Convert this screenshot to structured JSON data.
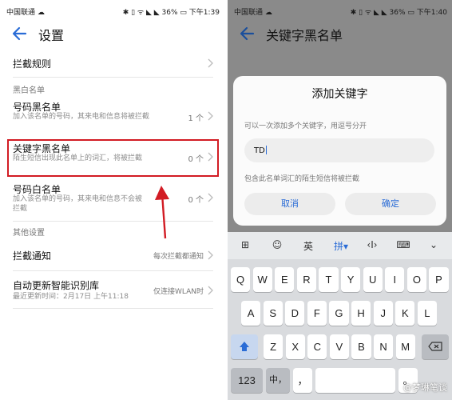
{
  "left": {
    "status": {
      "carrier": "中国联通 ☁",
      "right": "✱ ▯ ᯤ ◣ ◣ 36% ▭ 下午1:39"
    },
    "title": "设置",
    "intercept_rules": "拦截规则",
    "section_bw": "黑白名单",
    "number_blacklist": {
      "title": "号码黑名单",
      "desc": "加入该名单的号码，其来电和信息将被拦截",
      "count": "1 个"
    },
    "keyword_blacklist": {
      "title": "关键字黑名单",
      "desc": "陌生短信出现此名单上的词汇，将被拦截",
      "count": "0 个"
    },
    "number_whitelist": {
      "title": "号码白名单",
      "desc": "加入该名单的号码，其来电和信息不会被拦截",
      "count": "0 个"
    },
    "section_other": "其他设置",
    "intercept_notify": {
      "title": "拦截通知",
      "value": "每次拦截都通知"
    },
    "auto_update": {
      "title": "自动更新智能识别库",
      "desc": "最近更新时间：2月17日 上午11:18",
      "value": "仅连接WLAN时"
    }
  },
  "right": {
    "status": {
      "carrier": "中国联通 ☁",
      "right": "✱ ▯ ᯤ ◣ ◣ 36% ▭ 下午1:40"
    },
    "title": "关键字黑名单",
    "dialog": {
      "title": "添加关键字",
      "hint": "可以一次添加多个关键字，用逗号分开",
      "input_value": "TD",
      "note": "包含此名单词汇的陌生短信将被拦截",
      "cancel": "取消",
      "ok": "确定"
    },
    "keyboard": {
      "toolbar": [
        "⊞",
        "☺",
        "英",
        "拼▾",
        "‹I›",
        "⌨",
        "⌄"
      ],
      "row1": [
        "Q",
        "W",
        "E",
        "R",
        "T",
        "Y",
        "U",
        "I",
        "O",
        "P"
      ],
      "row2": [
        "A",
        "S",
        "D",
        "F",
        "G",
        "H",
        "J",
        "K",
        "L"
      ],
      "row3": [
        "Z",
        "X",
        "C",
        "V",
        "B",
        "N",
        "M"
      ],
      "num": "123",
      "cn": "中，",
      "comma": "，",
      "dot": "。",
      "watermark": "@梦琳笔谈"
    }
  },
  "colors": {
    "accent": "#2a6cd6",
    "highlight": "#d21c24"
  }
}
